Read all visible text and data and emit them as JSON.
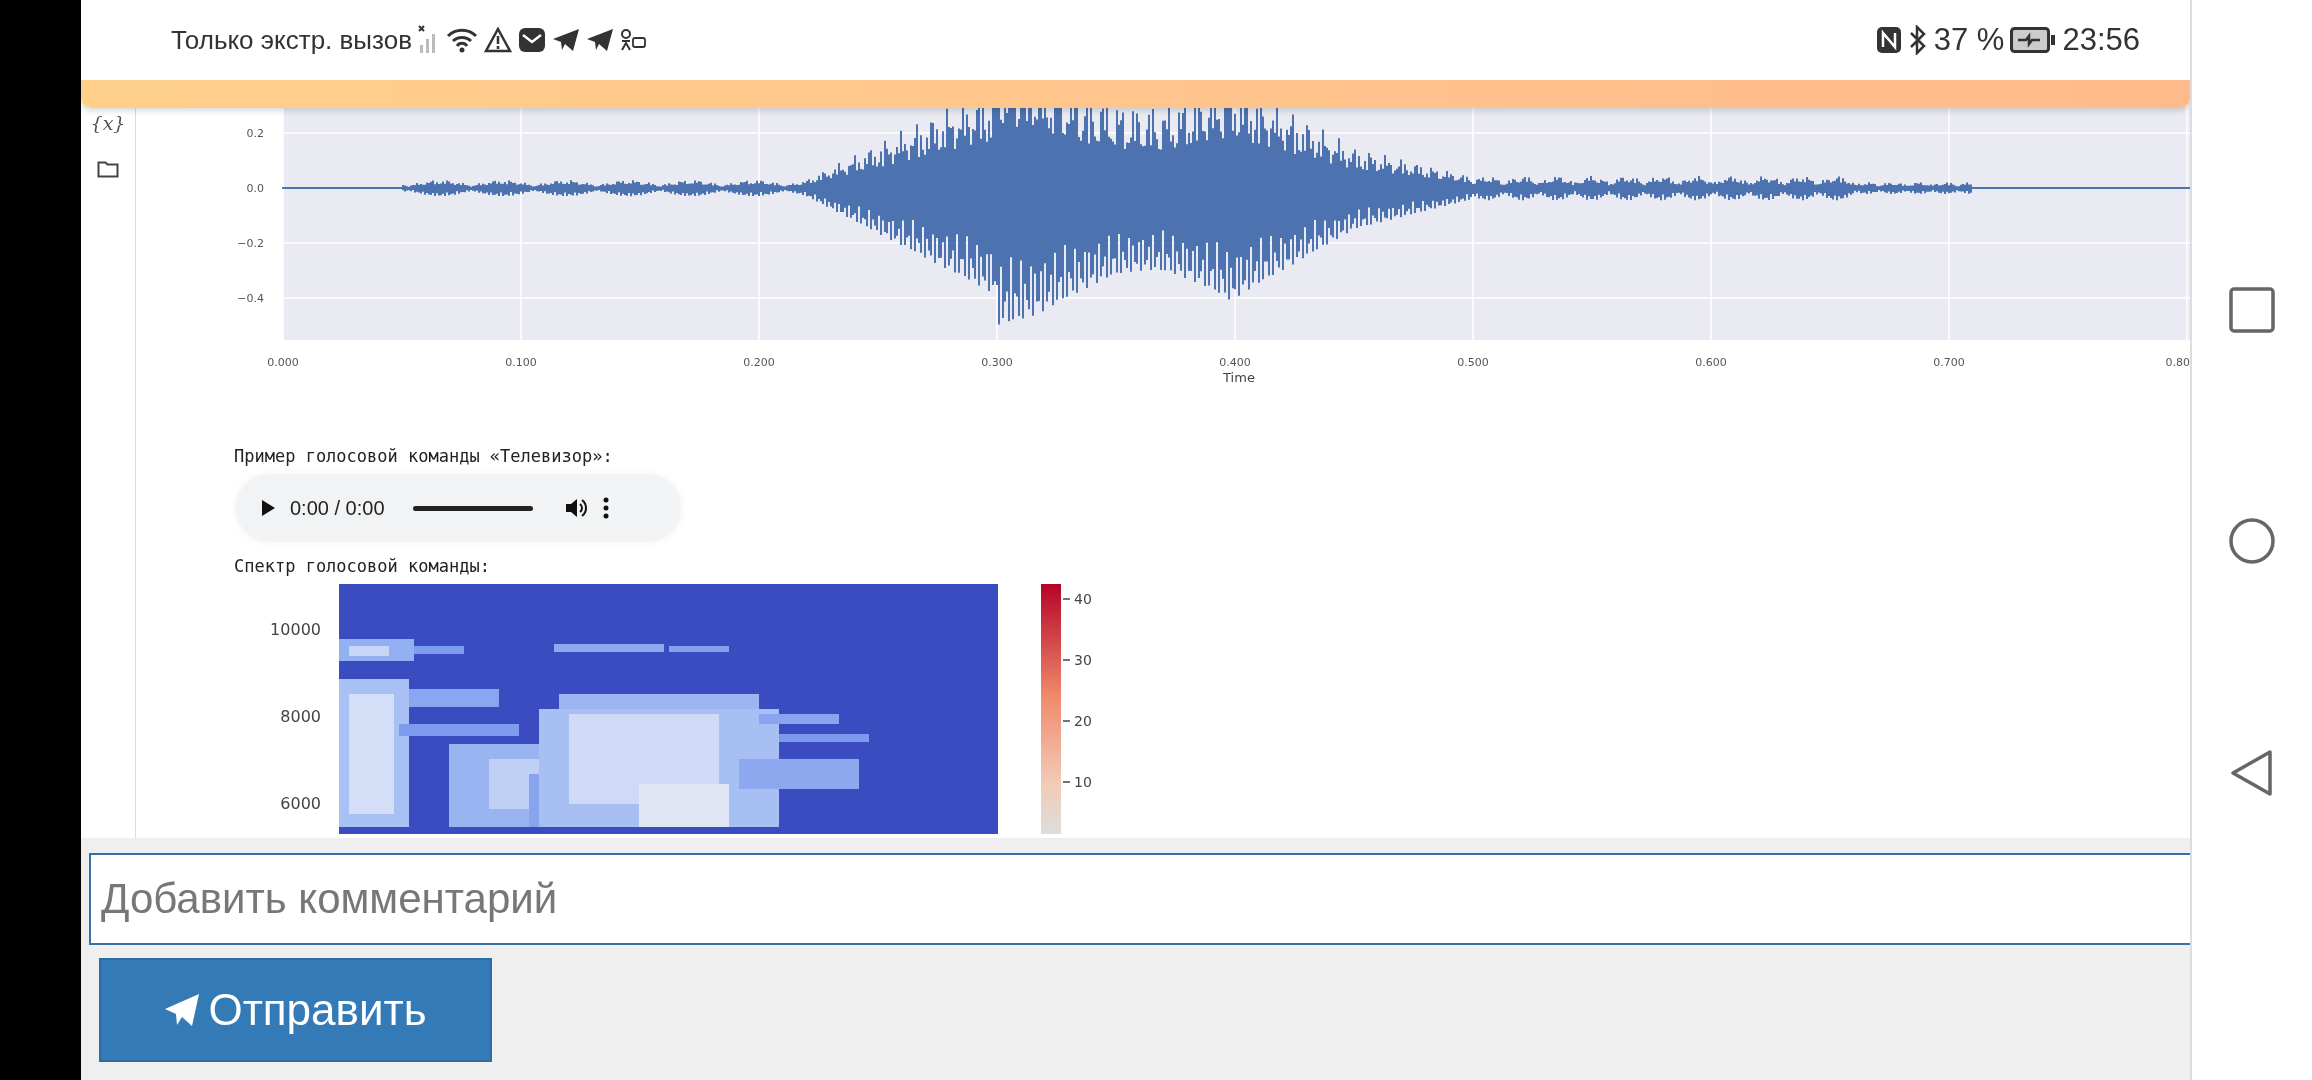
{
  "status_bar": {
    "carrier": "Только экстр. вызов",
    "battery": "37 %",
    "time": "23:56"
  },
  "sidebar": {
    "variables_label": "{x}"
  },
  "waveform_plot": {
    "y_ticks": [
      "0.2",
      "0.0",
      "−0.2",
      "−0.4"
    ],
    "x_ticks": [
      "0.000",
      "0.100",
      "0.200",
      "0.300",
      "0.400",
      "0.500",
      "0.600",
      "0.700",
      "0.80"
    ],
    "xlabel": "Time"
  },
  "audio_example": {
    "caption": "Пример голосовой команды «Телевизор»:",
    "player": {
      "time": "0:00 / 0:00"
    }
  },
  "spectrum": {
    "caption": "Спектр голосовой команды:",
    "y_ticks": [
      "10000",
      "8000",
      "6000"
    ],
    "colorbar_ticks": [
      "40",
      "30",
      "20",
      "10"
    ]
  },
  "comment": {
    "placeholder": "Добавить комментарий",
    "send_button": "Отправить"
  }
}
